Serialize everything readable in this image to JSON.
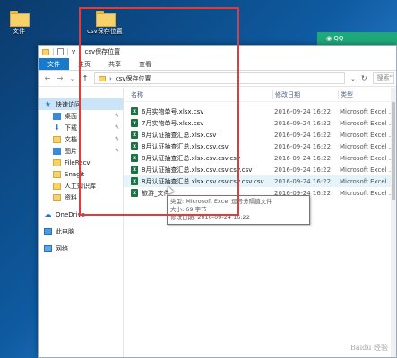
{
  "desktop": {
    "icons": [
      {
        "label": "文件"
      },
      {
        "label": "csv保存位置"
      }
    ],
    "qq_label": "QQ"
  },
  "window": {
    "title_path": "csv保存位置",
    "title_prefix": "v",
    "ribbon_tabs": [
      "文件",
      "主页",
      "共享",
      "查看"
    ],
    "address": "csv保存位置",
    "search_placeholder": "搜索\""
  },
  "navpane": {
    "items": [
      {
        "label": "快速访问",
        "icon": "star-icon",
        "pinned": false
      },
      {
        "label": "桌面",
        "icon": "desktop-icon",
        "pinned": true
      },
      {
        "label": "下载",
        "icon": "download-icon",
        "pinned": true
      },
      {
        "label": "文档",
        "icon": "document-icon",
        "pinned": true
      },
      {
        "label": "图片",
        "icon": "picture-icon",
        "pinned": true
      },
      {
        "label": "FileRecv",
        "icon": "folder-icon",
        "pinned": false
      },
      {
        "label": "Snagit",
        "icon": "folder-icon",
        "pinned": false
      },
      {
        "label": "人工知识库",
        "icon": "folder-icon",
        "pinned": false
      },
      {
        "label": "资料",
        "icon": "folder-icon",
        "pinned": false
      },
      {
        "label": "OneDrive",
        "icon": "cloud-icon",
        "pinned": false
      },
      {
        "label": "此电脑",
        "icon": "computer-icon",
        "pinned": false
      },
      {
        "label": "网络",
        "icon": "network-icon",
        "pinned": false
      }
    ]
  },
  "files": {
    "columns": [
      "名称",
      "修改日期",
      "类型"
    ],
    "rows": [
      {
        "name": "6月实物单号.xlsx.csv",
        "date": "2016-09-24 16:22",
        "type": "Microsoft Excel ..."
      },
      {
        "name": "7月实物单号.xlsx.csv",
        "date": "2016-09-24 16:22",
        "type": "Microsoft Excel ..."
      },
      {
        "name": "8月认证抽查汇总.xlsx.csv",
        "date": "2016-09-24 16:22",
        "type": "Microsoft Excel ..."
      },
      {
        "name": "8月认证抽查汇总.xlsx.csv.csv",
        "date": "2016-09-24 16:22",
        "type": "Microsoft Excel ..."
      },
      {
        "name": "8月认证抽查汇总.xlsx.csv.csv.csv",
        "date": "2016-09-24 16:22",
        "type": "Microsoft Excel ..."
      },
      {
        "name": "8月认证抽查汇总.xlsx.csv.csv.csv.csv",
        "date": "2016-09-24 16:22",
        "type": "Microsoft Excel ..."
      },
      {
        "name": "8月认证抽查汇总.xlsx.csv.csv.csv.csv.csv",
        "date": "2016-09-24 16:22",
        "type": "Microsoft Excel ..."
      },
      {
        "name": "旅游_文件",
        "date": "2016-09-24 16:22",
        "type": "Microsoft Excel ..."
      }
    ]
  },
  "tooltip": {
    "line1": "类型: Microsoft Excel 逗号分隔值文件",
    "line2": "大小: 69 字节",
    "line3": "修改日期: 2016-09-24 16:22"
  },
  "watermark": "Baidu 经验"
}
